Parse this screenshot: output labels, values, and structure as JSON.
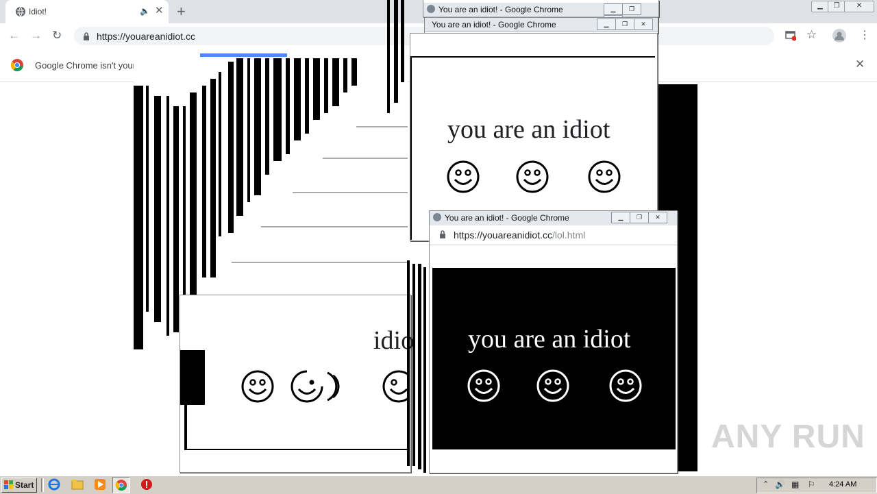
{
  "browser": {
    "tab_title": "Idiot!",
    "tab_close": "✕",
    "new_tab": "+",
    "url": "https://youareanidiot.cc",
    "infobar_message": "Google Chrome isn't your defau",
    "infobar_close": "✕"
  },
  "popups": {
    "window_title": "You are an idiot! - Google Chrome",
    "window_title_partial": "You are an idiot! - Google Chrome",
    "url_host": "https://youareanidiot.cc",
    "url_path": "/lol.html"
  },
  "content": {
    "slogan": "you are an idiot",
    "slogan_fragment": "idio"
  },
  "taskbar": {
    "start_label": "Start",
    "clock": "4:24 AM"
  },
  "watermark": "ANY RUN",
  "colors": {
    "tab_strip": "#dee1e6",
    "popup_title": "#e4e8ee",
    "inverted_bg": "#000000",
    "taskbar": "#d4d0c8"
  }
}
